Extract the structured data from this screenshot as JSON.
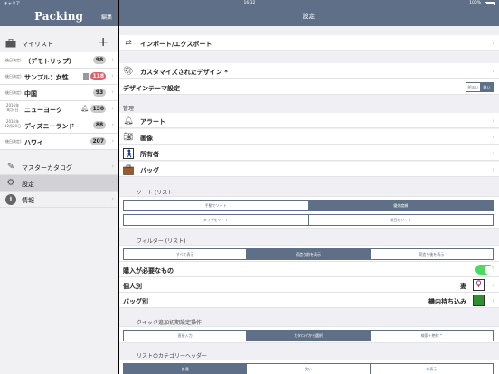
{
  "status_bar": {
    "carrier": "キャリア",
    "time": "16:32",
    "battery": "100%"
  },
  "sidebar": {
    "title": "Packing",
    "edit_label": "編集",
    "mylist_label": "マイリスト",
    "add_symbol": "+",
    "lists": [
      {
        "date": "(後日決定)",
        "name": "（デモトリップ）",
        "count": "98",
        "accent": false,
        "extra": ""
      },
      {
        "date": "(後日決定)",
        "name": "サンプル：女性",
        "count": "118",
        "accent": true,
        "extra": "note"
      },
      {
        "date": "(後日決定)",
        "name": "中国",
        "count": "93",
        "accent": false,
        "extra": ""
      },
      {
        "date_line1": "2016年",
        "date_line2": "8月4日",
        "name": "ニューヨーク",
        "count": "130",
        "accent": false,
        "extra": "bell"
      },
      {
        "date_line1": "2016年",
        "date_line2": "12月20日",
        "name": "ディズニーランド",
        "count": "88",
        "accent": false,
        "extra": ""
      },
      {
        "date": "(後日決定)",
        "name": "ハワイ",
        "count": "207",
        "accent": false,
        "extra": ""
      }
    ],
    "nav": [
      {
        "icon": "pen-icon",
        "label": "マスターカタログ",
        "selected": false
      },
      {
        "icon": "gear-icon",
        "label": "設定",
        "selected": true
      },
      {
        "icon": "info-icon",
        "label": "情報",
        "selected": false
      }
    ]
  },
  "main": {
    "title": "設定",
    "import_export": "インポート/エクスポート",
    "customized_design": "カスタマイズされたデザイン *",
    "design_theme": "デザインテーマ設定",
    "theme_options": [
      "明るい",
      "暗い"
    ],
    "management_header": "管理",
    "management": [
      {
        "icon": "bell-icon",
        "label": "アラート"
      },
      {
        "icon": "camera-icon",
        "label": "画像"
      },
      {
        "icon": "person-icon",
        "label": "所有者"
      },
      {
        "icon": "bag-icon",
        "label": "バッグ"
      }
    ],
    "sort_header": "ソート (リスト)",
    "sort_options": [
      "手動でソート",
      "優先度順"
    ],
    "sort_options_2": [
      "タイプをソート",
      "項目をソート"
    ],
    "filter_header": "フィルター (リスト)",
    "filter_options": [
      "すべて表示",
      "荷造り前を表示",
      "荷造り後を表示"
    ],
    "need_purchase": "購入が必要なもの",
    "per_person": "個人別",
    "per_person_value": "妻",
    "per_bag": "バッグ別",
    "per_bag_value": "機内持ち込み",
    "quick_add_header": "クイック追加初期設定操作",
    "quick_add_options": [
      "直接入力",
      "カタログから選択",
      "検索＋絶除 *"
    ],
    "category_header": "リストのカテゴリーヘッダー",
    "category_options": [
      "普通",
      "狭い",
      "非表示"
    ],
    "colors": {
      "accent": "#5f6f87",
      "badge_red": "#e0606a",
      "switch_on": "#4cd964"
    }
  }
}
